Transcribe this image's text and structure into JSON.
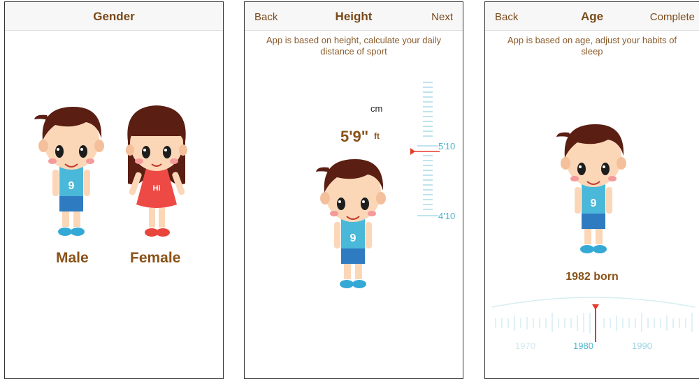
{
  "screen1": {
    "title": "Gender",
    "male_label": "Male",
    "female_label": "Female",
    "male_shirt": "9",
    "female_shirt": "Hi"
  },
  "screen2": {
    "back": "Back",
    "title": "Height",
    "next": "Next",
    "description": "App is based on height, calculate your daily distance of sport",
    "unit_alt": "cm",
    "height_value": "5'9\"",
    "height_unit": "ft",
    "ruler_label_upper": "5'10",
    "ruler_label_lower": "4'10",
    "shirt": "9"
  },
  "screen3": {
    "back": "Back",
    "title": "Age",
    "complete": "Complete",
    "description": "App is based on age, adjust your habits of sleep",
    "born_text": "1982 born",
    "year_labels": [
      "1970",
      "1980",
      "1990"
    ],
    "shirt": "9"
  },
  "colors": {
    "title_brown": "#7a4a1a",
    "label_brown": "#8a5218",
    "ruler_cyan": "#4fb6cc",
    "indicator_red": "#e53a2a",
    "hair": "#5a1e12",
    "skin": "#fbd7b8",
    "shirt_cyan": "#4ab8d8",
    "shorts_blue": "#2f7bc2",
    "dress_red": "#ee4a45"
  }
}
